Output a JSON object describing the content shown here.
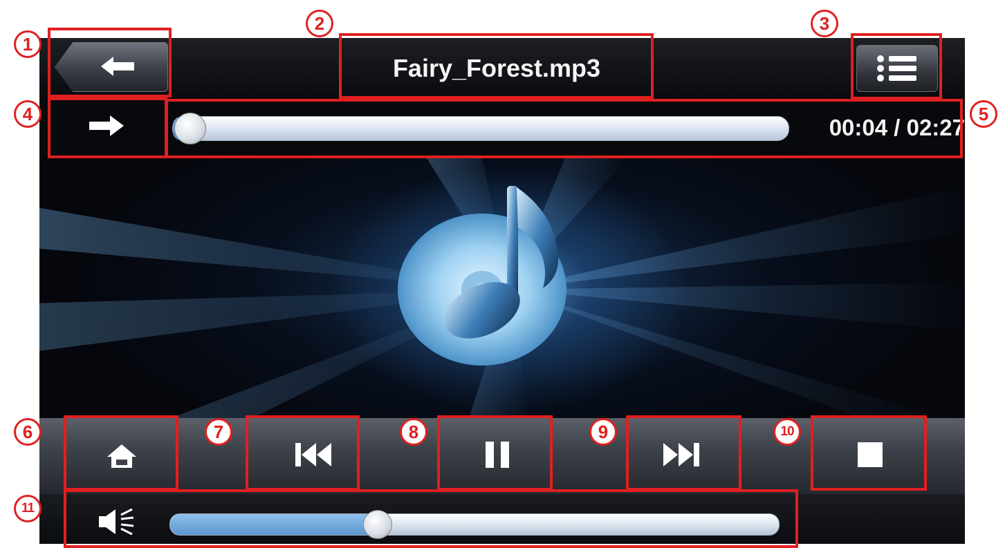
{
  "track": {
    "title": "Fairy_Forest.mp3",
    "elapsed": "00:04",
    "duration": "02:27",
    "time_display": "00:04 / 02:27",
    "progress_fraction": 0.027
  },
  "volume": {
    "level_fraction": 0.34
  },
  "icons": {
    "back": "left-arrow-icon",
    "playlist": "list-icon",
    "repeat": "right-arrow-icon",
    "home": "home-icon",
    "previous": "skip-previous-icon",
    "pause": "pause-icon",
    "next": "skip-next-icon",
    "stop": "stop-icon",
    "volume": "speaker-icon",
    "artwork": "music-note-disc-icon"
  },
  "annotations": [
    "1",
    "2",
    "3",
    "4",
    "5",
    "6",
    "7",
    "8",
    "9",
    "10",
    "11"
  ],
  "colors": {
    "annotation_red": "#e02020",
    "progress_fill": "#4a88c8",
    "background": "#05060b"
  }
}
